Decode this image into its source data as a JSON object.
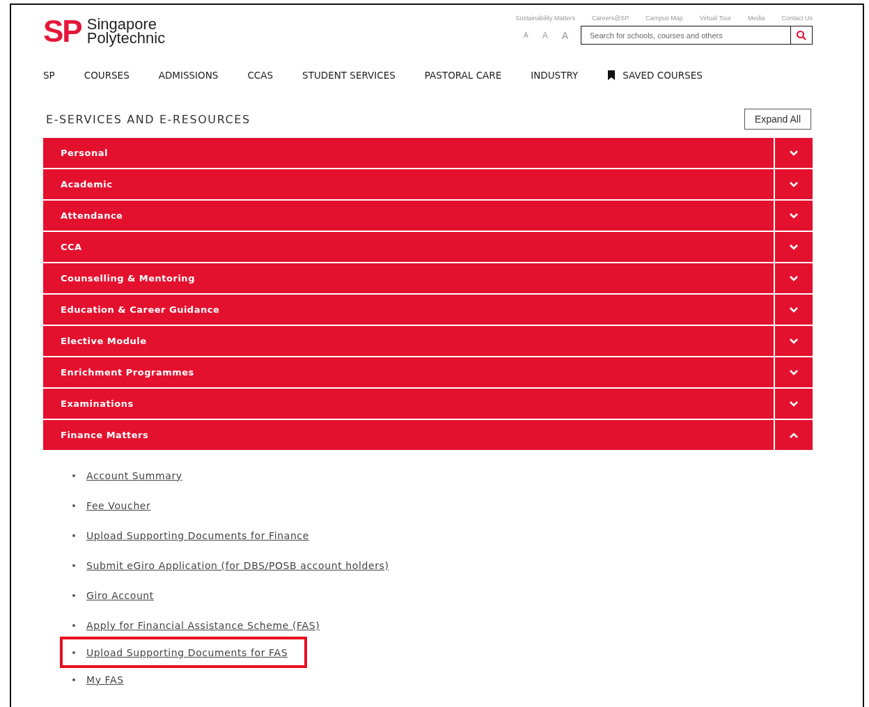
{
  "logo": {
    "mark": "SP",
    "name_line_1": "Singapore",
    "name_line_2": "Polytechnic"
  },
  "utility_links": [
    "Sustainability Matters",
    "Careers@SP",
    "Campus Map",
    "Virtual Tour",
    "Media",
    "Contact Us"
  ],
  "font_size_buttons": [
    "A",
    "A",
    "A"
  ],
  "search": {
    "placeholder": "Search for schools, courses and others"
  },
  "nav": [
    {
      "label": "SP",
      "kind": "text"
    },
    {
      "label": "COURSES",
      "kind": "text"
    },
    {
      "label": "ADMISSIONS",
      "kind": "text"
    },
    {
      "label": "CCAS",
      "kind": "text"
    },
    {
      "label": "STUDENT SERVICES",
      "kind": "text"
    },
    {
      "label": "PASTORAL CARE",
      "kind": "text"
    },
    {
      "label": "INDUSTRY",
      "kind": "text"
    },
    {
      "label": "SAVED COURSES",
      "kind": "bookmark"
    }
  ],
  "section_title": "E-SERVICES AND E-RESOURCES",
  "expand_button": "Expand All",
  "accordion": [
    {
      "label": "Personal",
      "expanded": false
    },
    {
      "label": "Academic",
      "expanded": false
    },
    {
      "label": "Attendance",
      "expanded": false
    },
    {
      "label": "CCA",
      "expanded": false
    },
    {
      "label": "Counselling & Mentoring",
      "expanded": false
    },
    {
      "label": "Education & Career Guidance",
      "expanded": false
    },
    {
      "label": "Elective Module",
      "expanded": false
    },
    {
      "label": "Enrichment Programmes",
      "expanded": false
    },
    {
      "label": "Examinations",
      "expanded": false
    },
    {
      "label": "Finance Matters",
      "expanded": true,
      "links": [
        {
          "label": "Account Summary",
          "highlighted": false
        },
        {
          "label": "Fee Voucher",
          "highlighted": false
        },
        {
          "label": "Upload Supporting Documents for Finance",
          "highlighted": false
        },
        {
          "label": "Submit eGiro Application (for DBS/POSB account holders)",
          "highlighted": false
        },
        {
          "label": "Giro Account",
          "highlighted": false
        },
        {
          "label": "Apply for Financial Assistance Scheme (FAS)",
          "highlighted": false
        },
        {
          "label": "Upload Supporting Documents for FAS",
          "highlighted": true
        },
        {
          "label": "My FAS",
          "highlighted": false
        }
      ]
    }
  ]
}
